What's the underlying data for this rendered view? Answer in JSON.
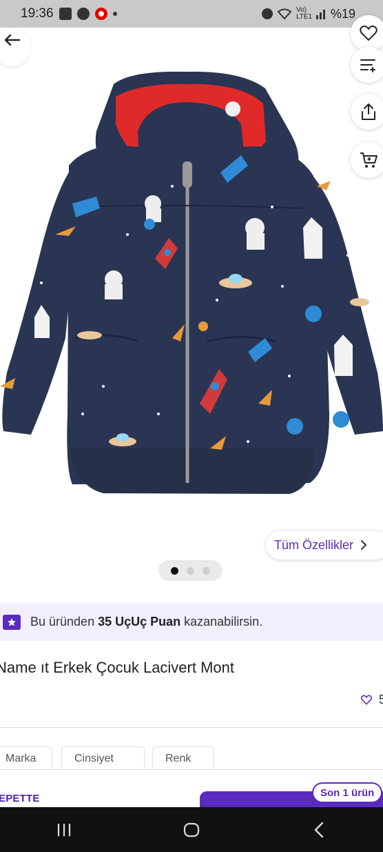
{
  "status_bar": {
    "time": "19:36",
    "network": "Vo) LTE1",
    "battery": "%19"
  },
  "product_actions": {
    "back_icon": "arrow-left-icon",
    "favorite_icon": "heart-outline-icon",
    "filter_icon": "filter-list-icon",
    "share_icon": "share-icon",
    "cart_icon": "cart-icon"
  },
  "gallery": {
    "all_features_label": "Tüm Özellikler",
    "page_count": 3,
    "active_page": 1
  },
  "points_banner": {
    "prefix": "Bu üründen ",
    "highlight": "35 UçUç Puan",
    "suffix": " kazanabilirsin."
  },
  "product": {
    "title": "Name ıt Erkek Çocuk Lacivert Mont",
    "favorite_count": "5"
  },
  "tabs": [
    {
      "label": "Marka"
    },
    {
      "label": "Cinsiyet"
    },
    {
      "label": "Renk"
    }
  ],
  "bottom": {
    "sepette_label": "EPETTE",
    "stock_label": "Son 1 ürün"
  },
  "colors": {
    "accent": "#5b2bbf",
    "banner_bg": "#f3efff",
    "jacket": "#2a3553",
    "hood_lining": "#e02a2a"
  }
}
